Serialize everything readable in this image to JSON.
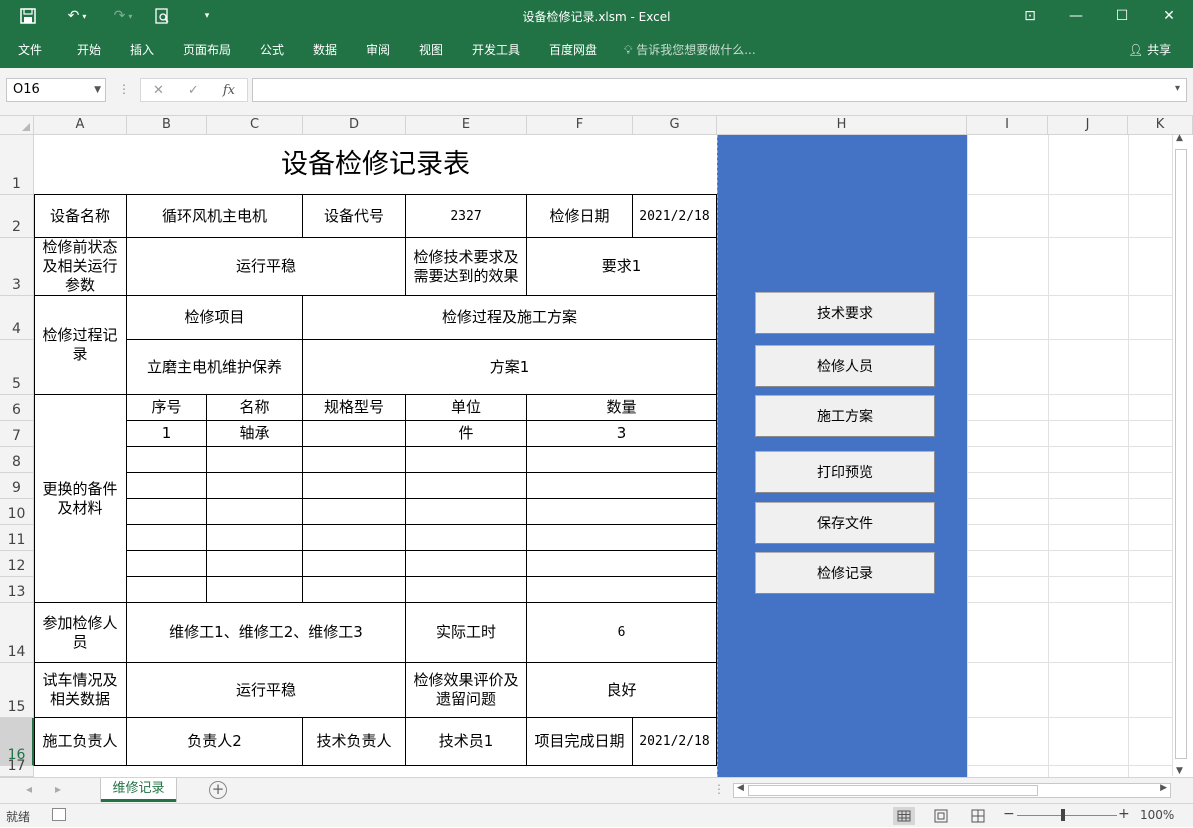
{
  "window": {
    "title": "设备检修记录.xlsm - Excel",
    "tabs": [
      "文件",
      "开始",
      "插入",
      "页面布局",
      "公式",
      "数据",
      "审阅",
      "视图",
      "开发工具",
      "百度网盘"
    ],
    "tell_me": "告诉我您想要做什么...",
    "share": "共享",
    "min": "—",
    "max": "☐",
    "close": "✕",
    "ribbon_opts": "⊡"
  },
  "formula_bar": {
    "name_box": "O16",
    "cancel": "✕",
    "enter": "✓",
    "fx": "fx",
    "value": ""
  },
  "columns": [
    "A",
    "B",
    "C",
    "D",
    "E",
    "F",
    "G",
    "H",
    "I",
    "J",
    "K"
  ],
  "rows": [
    "1",
    "2",
    "3",
    "4",
    "5",
    "6",
    "7",
    "8",
    "9",
    "10",
    "11",
    "12",
    "13",
    "14",
    "15",
    "16",
    "17"
  ],
  "form": {
    "title": "设备检修记录表",
    "equip_name_label": "设备名称",
    "equip_name": "循环风机主电机",
    "equip_code_label": "设备代号",
    "equip_code": "2327",
    "date_label": "检修日期",
    "date": "2021/2/18",
    "pre_state_label": "检修前状态及相关运行参数",
    "pre_state": "运行平稳",
    "tech_req_label": "检修技术要求及需要达到的效果",
    "tech_req": "要求1",
    "process_label": "检修过程记录",
    "item_label": "检修项目",
    "plan_label": "检修过程及施工方案",
    "item": "立磨主电机维护保养",
    "plan": "方案1",
    "parts_label": "更换的备件及材料",
    "parts_headers": [
      "序号",
      "名称",
      "规格型号",
      "单位",
      "数量"
    ],
    "parts_rows": [
      [
        "1",
        "轴承",
        "",
        "件",
        "3"
      ],
      [
        "",
        "",
        "",
        "",
        ""
      ],
      [
        "",
        "",
        "",
        "",
        ""
      ],
      [
        "",
        "",
        "",
        "",
        ""
      ],
      [
        "",
        "",
        "",
        "",
        ""
      ],
      [
        "",
        "",
        "",
        "",
        ""
      ],
      [
        "",
        "",
        "",
        "",
        ""
      ]
    ],
    "workers_label": "参加检修人员",
    "workers": "维修工1、维修工2、维修工3",
    "hours_label": "实际工时",
    "hours": "6",
    "trial_label": "试车情况及相关数据",
    "trial": "运行平稳",
    "eval_label": "检修效果评价及遗留问题",
    "eval": "良好",
    "lead_label": "施工负责人",
    "lead": "负责人2",
    "tech_lead_label": "技术负责人",
    "tech_lead": "技术员1",
    "finish_label": "项目完成日期",
    "finish": "2021/2/18"
  },
  "buttons": [
    "技术要求",
    "检修人员",
    "施工方案",
    "打印预览",
    "保存文件",
    "检修记录"
  ],
  "sheet_tab": "维修记录",
  "status": {
    "ready": "就绪",
    "zoom": "100%"
  },
  "colors": {
    "excel_green": "#217346",
    "panel_blue": "#4472c4"
  }
}
